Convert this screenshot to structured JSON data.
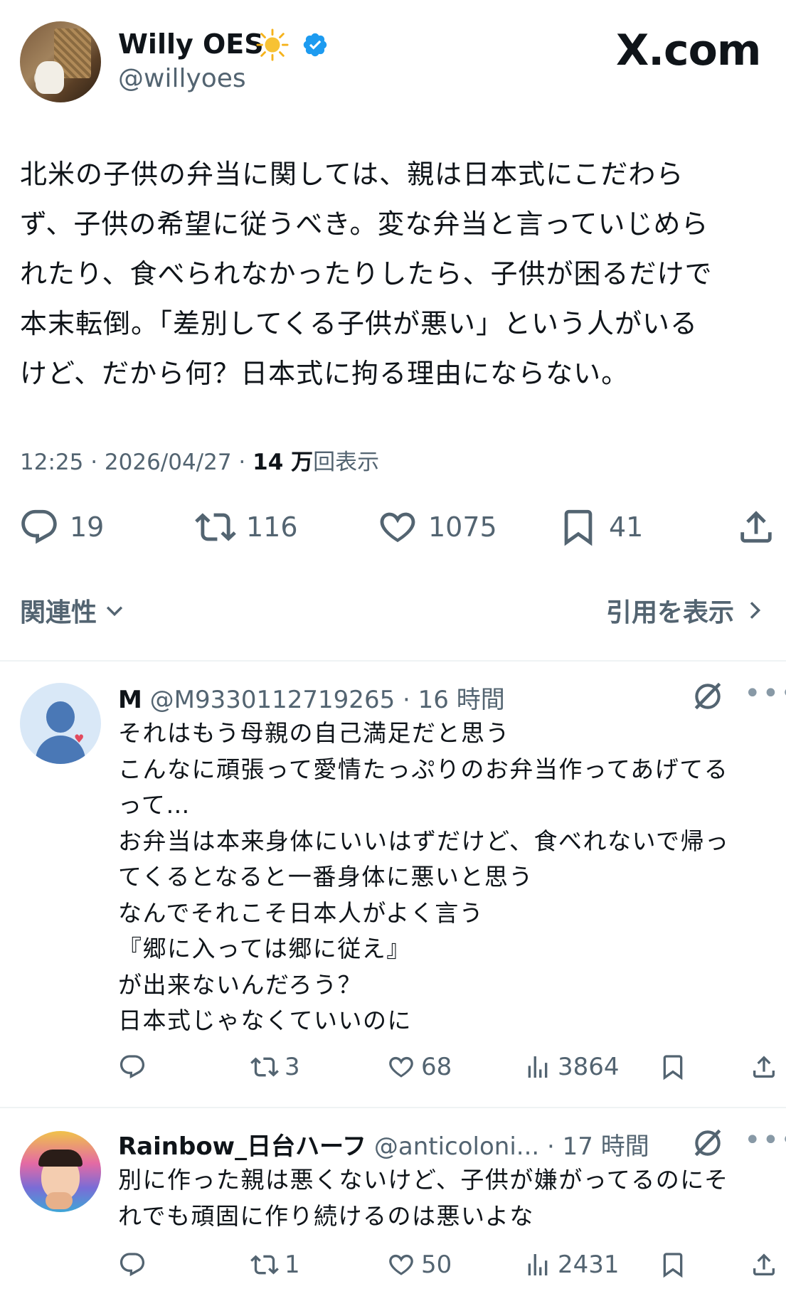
{
  "main_tweet": {
    "author": {
      "name": "Willy OES",
      "handle": "@willyoes"
    },
    "site_logo": "X.com",
    "text": "北米の子供の弁当に関しては、親は日本式にこだわら\nず、子供の希望に従うべき。変な弁当と言っていじめら\nれたり、食べられなかったりしたら、子供が困るだけで\n本末転倒。「差別してくる子供が悪い」という人がいる\nけど、だから何？日本式に拘る理由にならない。",
    "timestamp": "12:25 · 2026/04/27 · ",
    "views_count": "14 万",
    "views_label": "回表示",
    "stats": {
      "replies": "19",
      "retweets": "116",
      "likes": "1075",
      "bookmarks": "41"
    }
  },
  "controls": {
    "sort_label": "関連性",
    "quotes_label": "引用を表示"
  },
  "replies": [
    {
      "name": "M",
      "handle": "@M9330112719265",
      "time": "· 16 時間",
      "text": "それはもう母親の自己満足だと思う\nこんなに頑張って愛情たっぷりのお弁当作ってあげてる\nって…\nお弁当は本来身体にいいはずだけど、食べれないで帰っ\nてくるとなると一番身体に悪いと思う\nなんでそれこそ日本人がよく言う\n『郷に入っては郷に従え』\nが出来ないんだろう？\n日本式じゃなくていいのに",
      "stats": {
        "retweets": "3",
        "likes": "68",
        "views": "3864"
      }
    },
    {
      "name": "Rainbow_日台ハーフ",
      "handle": "@anticoloni...",
      "time": "· 17 時間",
      "text": "別に作った親は悪くないけど、子供が嫌がってるのにそ\nれでも頑固に作り続けるのは悪いよな",
      "stats": {
        "retweets": "1",
        "likes": "50",
        "views": "2431"
      }
    }
  ],
  "colors": {
    "text": "#0f1419",
    "secondary": "#536471",
    "verified": "#1d9bf0",
    "divider": "#eff3f4",
    "sun": "#f5b21b"
  },
  "icons": [
    "reply-icon",
    "retweet-icon",
    "like-icon",
    "bookmark-icon",
    "share-icon",
    "views-icon",
    "grok-icon",
    "more-icon",
    "verified-icon",
    "sun-icon",
    "chevron-down-icon",
    "chevron-right-icon"
  ]
}
